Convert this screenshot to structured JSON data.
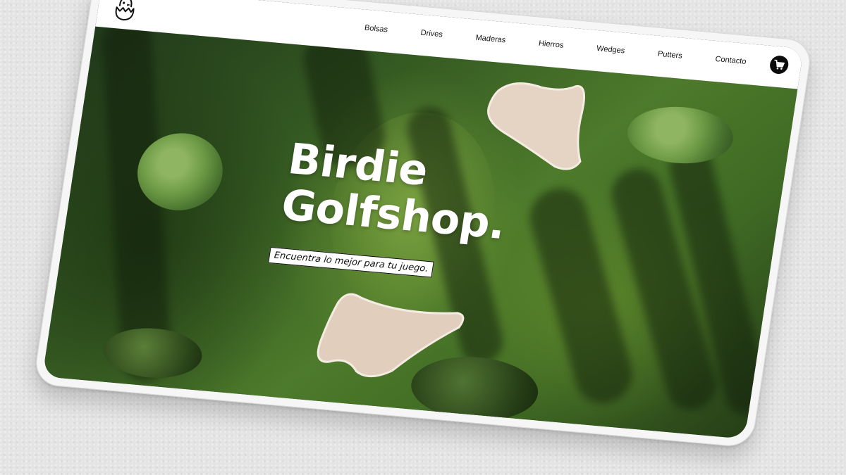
{
  "brand": {
    "logo_icon": "chick-in-egg-icon"
  },
  "nav": {
    "items": [
      {
        "label": "Bolsas"
      },
      {
        "label": "Drives"
      },
      {
        "label": "Maderas"
      },
      {
        "label": "Hierros"
      },
      {
        "label": "Wedges"
      },
      {
        "label": "Putters"
      },
      {
        "label": "Contacto"
      }
    ],
    "cart_icon": "shopping-cart-icon"
  },
  "hero": {
    "title_line1": "Birdie",
    "title_line2": "Golfshop.",
    "tagline": "Encuentra lo mejor para tu juego.",
    "background": "aerial-golf-course-photo"
  },
  "colors": {
    "nav_bg": "#ffffff",
    "cart_bg": "#0b0b0b",
    "title": "#ffffff",
    "grass": "#4d7a2b",
    "sand": "#e8d8c8"
  }
}
